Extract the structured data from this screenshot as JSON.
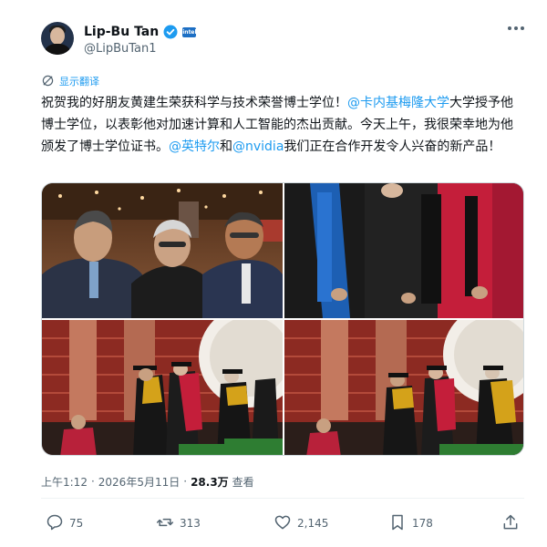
{
  "author": {
    "display_name": "Lip-Bu Tan",
    "handle": "@LipBuTan1",
    "affiliation_badge": "intel"
  },
  "translate_label": "显示翻译",
  "tweet": {
    "part1": "祝贺我的好朋友黄建生荣获科学与技术荣誉博士学位！",
    "mention_cmu": "@卡内基梅隆大学",
    "part2": "大学授予他博士学位，以表彰他对加速计算和人工智能的杰出贡献。今天上午，我很荣幸地为他颁发了博士学位证书。",
    "mention_intel": "@英特尔",
    "connector": "和",
    "mention_nvidia": "@nvidia",
    "part3": "我们正在合作开发令人兴奋的新产品！"
  },
  "meta": {
    "time": "上午1:12",
    "separator": "·",
    "date": "2026年5月11日",
    "views_count": "28.3万",
    "views_label": "查看"
  },
  "actions": {
    "replies": "75",
    "reposts": "313",
    "likes": "2,145",
    "bookmarks": "178"
  },
  "icons": {
    "verified": "verified-badge-icon",
    "more": "more-options-icon",
    "translate": "translate-icon",
    "reply": "reply-icon",
    "repost": "repost-icon",
    "like": "like-icon",
    "bookmark": "bookmark-icon",
    "share": "share-icon"
  },
  "colors": {
    "link": "#1d9bf0",
    "text": "#0f1419",
    "secondary": "#536471",
    "intel_blue": "#1d6fc4",
    "gown_red": "#c41e3a"
  }
}
